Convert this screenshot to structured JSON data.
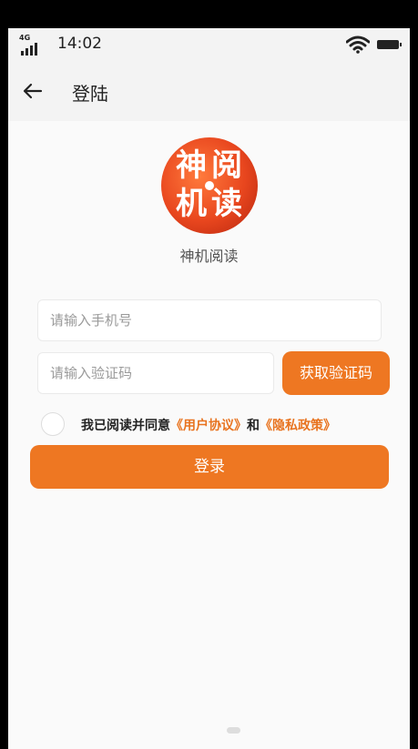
{
  "status_bar": {
    "network": "4G",
    "time": "14:02",
    "wifi_icon": "wifi-icon",
    "battery_icon": "battery-icon"
  },
  "header": {
    "back_icon": "arrow-left-icon",
    "title": "登陆"
  },
  "logo": {
    "chars": [
      "神",
      "阅",
      "机",
      "读"
    ]
  },
  "app_name": "神机阅读",
  "form": {
    "phone_placeholder": "请输入手机号",
    "code_placeholder": "请输入验证码",
    "get_code_label": "获取验证码"
  },
  "agreement": {
    "prefix": "我已阅读并同意",
    "user_agreement": "《用户协议》",
    "and": "和",
    "privacy_policy": "《隐私政策》"
  },
  "login_label": "登录",
  "colors": {
    "accent": "#ee7722",
    "background": "#fafafa",
    "header_bg": "#f3f3f3"
  }
}
